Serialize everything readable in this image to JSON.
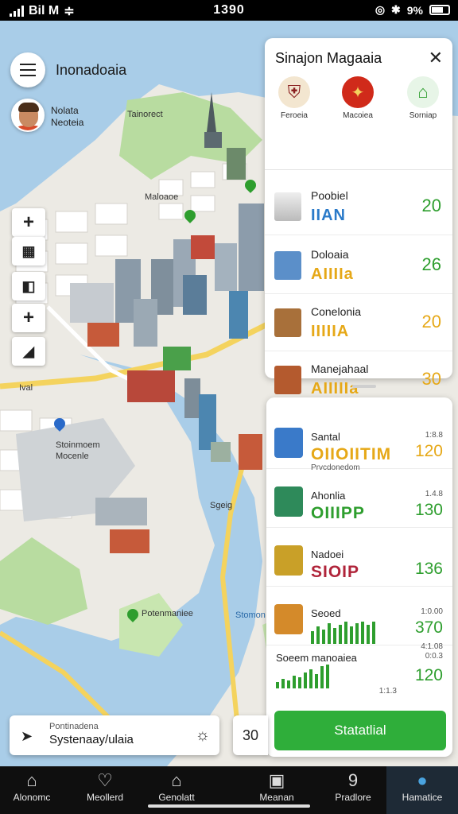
{
  "status_bar": {
    "carrier": "Bil M",
    "time": "1390",
    "battery": "9%"
  },
  "map": {
    "title": "Inonadoaia",
    "user": {
      "line1": "Nolata",
      "line2": "Neoteia"
    },
    "labels": {
      "top_area": "Tainorect",
      "district": "Maloaoe",
      "left_mark": "Ival",
      "station_line1": "Stoinmoem",
      "station_line2": "Mocenle",
      "bridge": "Sgeig",
      "park": "Potenmaniee",
      "sea": "Stomon"
    }
  },
  "panel_top": {
    "title": "Sinajon Magaaia",
    "categories": [
      {
        "label": "Feroeia",
        "icon": "shield-icon",
        "color": "#8a1f1f"
      },
      {
        "label": "Macoiea",
        "icon": "ribbon-icon",
        "color": "#d02a1a"
      },
      {
        "label": "Sorniap",
        "icon": "home-icon",
        "color": "#2e9e2e"
      }
    ],
    "rows": [
      {
        "name": "Poobiel",
        "code": "IIAN",
        "value": "20",
        "code_color": "#2a7ac9",
        "value_color": "#2e9e2e",
        "icon": "monument-icon"
      },
      {
        "name": "Doloaia",
        "code": "AIIIIa",
        "value": "26",
        "code_color": "#e6a817",
        "value_color": "#2e9e2e",
        "icon": "building-icon"
      },
      {
        "name": "Conelonia",
        "code": "IIIIIA",
        "value": "20",
        "code_color": "#e6a817",
        "value_color": "#e6a817",
        "icon": "temple-icon"
      },
      {
        "name": "Manejahaal",
        "code": "AIIIIIa",
        "value": "30",
        "code_color": "#e6a817",
        "value_color": "#e6a817",
        "icon": "palace-icon"
      }
    ]
  },
  "panel_bottom": {
    "rows": [
      {
        "name": "Santal",
        "code": "OIIOIITIM",
        "sub": "Prvcdonedom",
        "small": "1:8.8",
        "value": "120",
        "code_color": "#e6a817",
        "value_color": "#e6a817",
        "icon": "museum-icon"
      },
      {
        "name": "Ahonlia",
        "code": "OIIIPP",
        "sub": "",
        "small": "1.4.8",
        "value": "130",
        "code_color": "#2e9e2e",
        "value_color": "#2e9e2e",
        "icon": "drop-icon"
      },
      {
        "name": "Nadoei",
        "code": "SIOIP",
        "sub": "",
        "small": "",
        "value": "136",
        "code_color": "#b0243a",
        "value_color": "#2e9e2e",
        "icon": "shrine-icon"
      },
      {
        "name": "Seoed",
        "code": "",
        "sub": "",
        "small": "1:0.00",
        "value": "370",
        "code_color": "#2e9e2e",
        "value_color": "#2e9e2e",
        "icon": "market-icon",
        "sub2": "4:1.08"
      },
      {
        "name": "Soeem manoaiea",
        "code": "",
        "sub": "",
        "small": "0:0.3",
        "value": "120",
        "code_color": "#2e9e2e",
        "value_color": "#2e9e2e",
        "icon": "chart-icon",
        "sub2": "1:1.3"
      }
    ],
    "cta": "Statatlial"
  },
  "search": {
    "line1": "Pontinadena",
    "line2": "Systenaay/ulaia"
  },
  "mini_button": "30",
  "nav": [
    {
      "label": "Alonomc",
      "icon": "home-icon"
    },
    {
      "label": "Meollerd",
      "icon": "heart-icon"
    },
    {
      "label": "Genolatt",
      "icon": "store-icon"
    },
    {
      "label": "Meanan",
      "icon": "screen-icon"
    },
    {
      "label": "Pradlore",
      "icon": "nine-icon"
    },
    {
      "label": "Hamatice",
      "icon": "person-icon"
    }
  ]
}
